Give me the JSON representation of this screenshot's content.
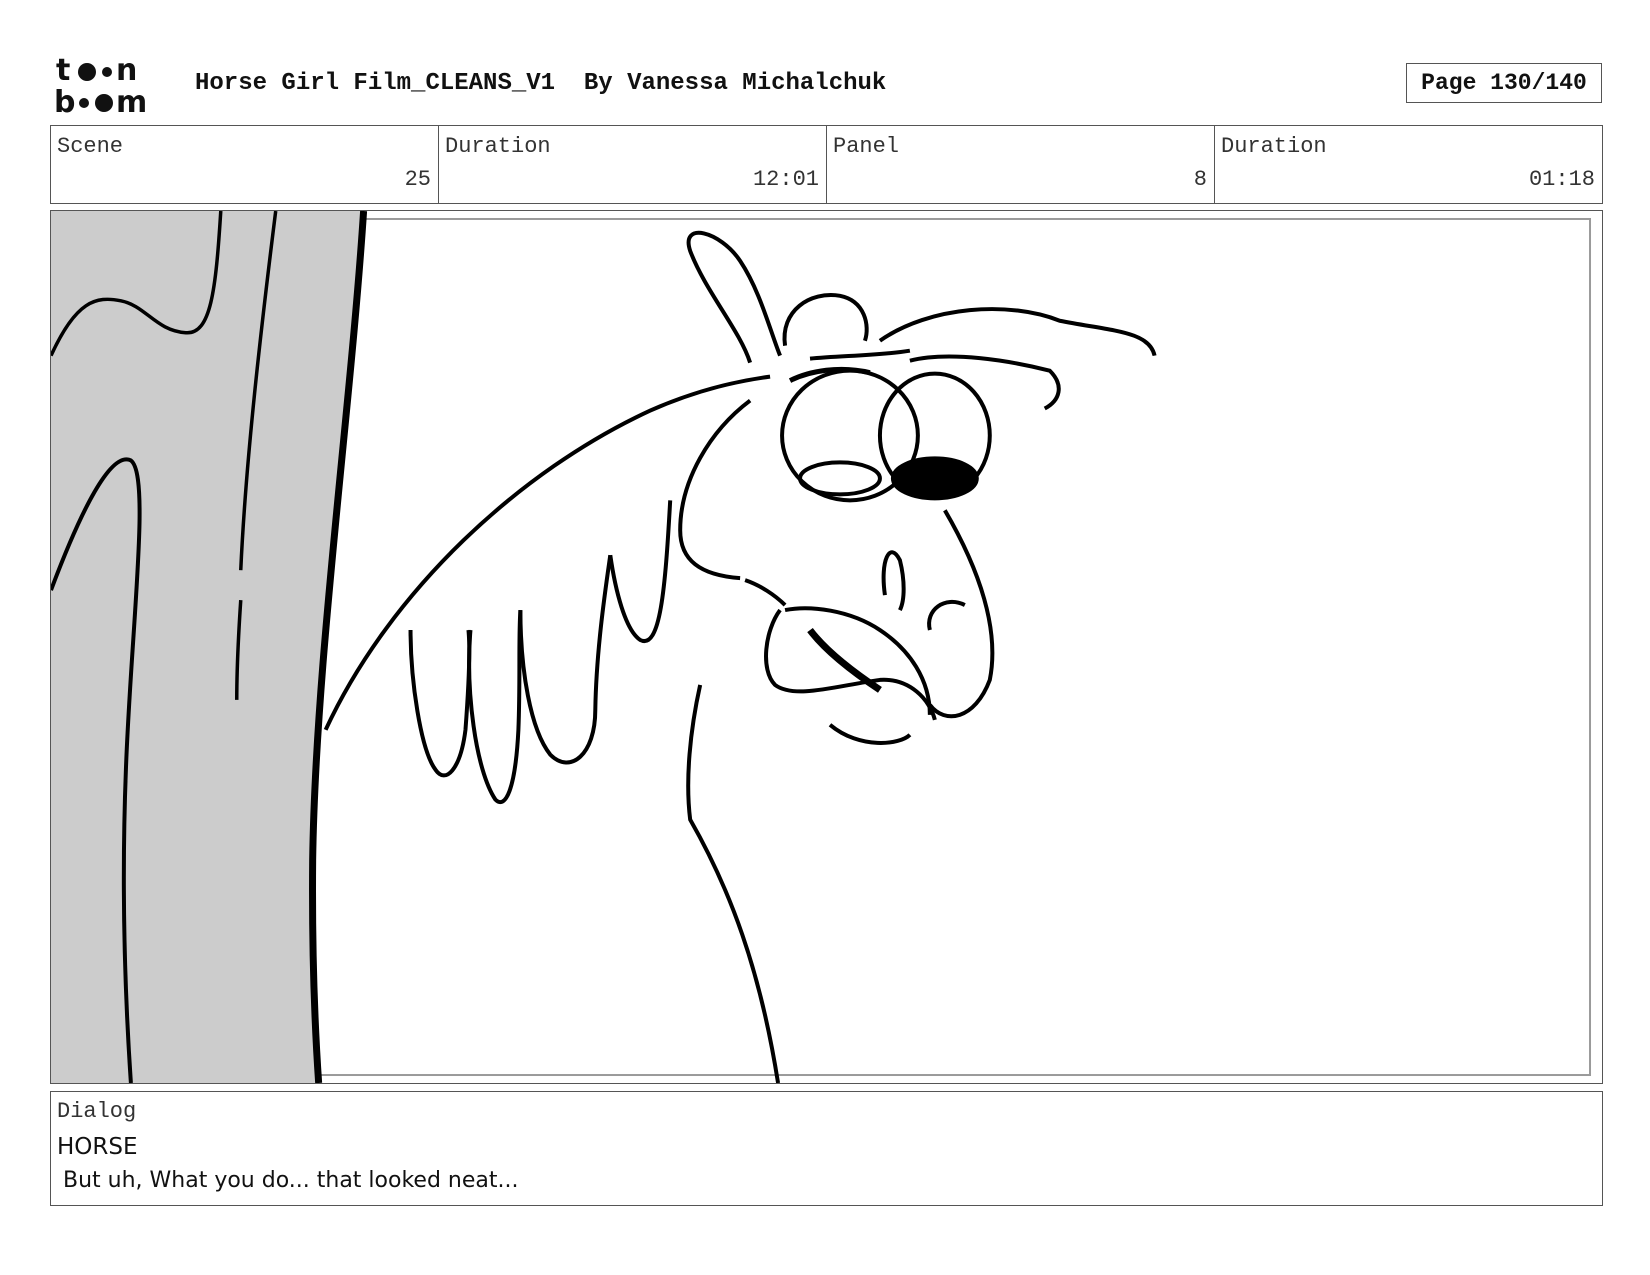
{
  "header": {
    "logo_text_top": "toon",
    "logo_text_bottom": "boom",
    "title": "Horse Girl Film_CLEANS_V1  By Vanessa Michalchuk",
    "page": "Page 130/140"
  },
  "info": {
    "scene_label": "Scene",
    "scene_value": "25",
    "scene_duration_label": "Duration",
    "scene_duration_value": "12:01",
    "panel_label": "Panel",
    "panel_value": "8",
    "panel_duration_label": "Duration",
    "panel_duration_value": "01:18"
  },
  "panel": {
    "content": "horse-sketch-drawing",
    "tree_fill": "#cccccc",
    "line_color": "#000000"
  },
  "dialog": {
    "label": "Dialog",
    "speaker": "HORSE",
    "line": "But uh, What you do... that looked neat..."
  }
}
